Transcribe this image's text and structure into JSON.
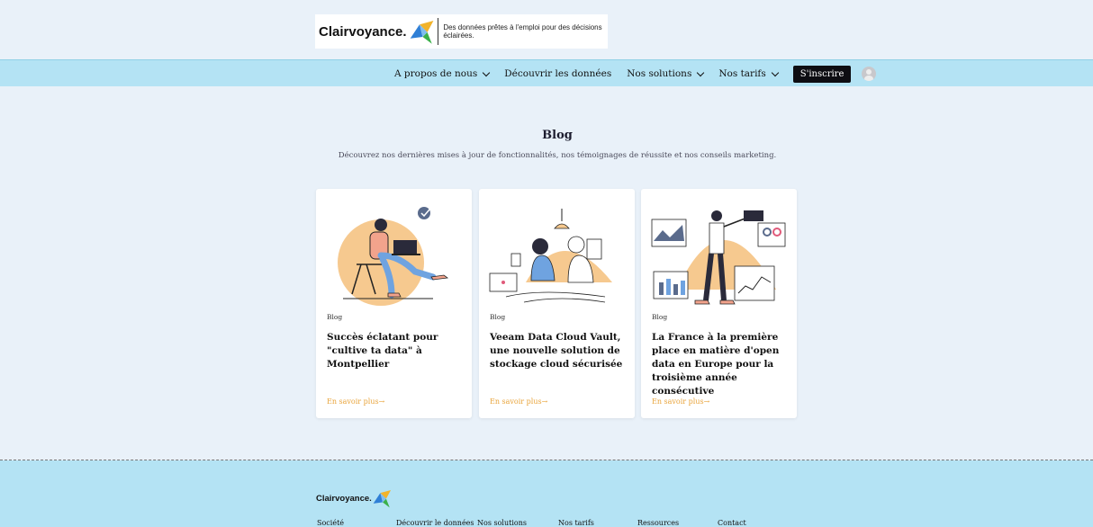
{
  "header": {
    "logo_text": "Clairvoyance.",
    "tagline": "Des données prêtes à l'emploi pour des décisions éclairées."
  },
  "nav": {
    "items": [
      {
        "label": "A propos de nous",
        "dropdown": true
      },
      {
        "label": "Découvrir les données",
        "dropdown": false
      },
      {
        "label": "Nos solutions",
        "dropdown": true
      },
      {
        "label": "Nos tarifs",
        "dropdown": true
      }
    ],
    "signup": "S'inscrire",
    "avatar_icon": "user-avatar-icon"
  },
  "main": {
    "title": "Blog",
    "subtitle": "Découvrez nos dernières mises à jour de fonctionnalités, nos témoignages de réussite et nos conseils marketing."
  },
  "cards": [
    {
      "category": "Blog",
      "title": "Succès éclatant pour \"cultive ta data\" à Montpellier",
      "link": "En savoir plus→",
      "illustration": "woman-laptop-chair-illustration"
    },
    {
      "category": "Blog",
      "title": "Veeam Data Cloud Vault, une nouvelle solution de stockage cloud sécurisée",
      "link": "En savoir plus→",
      "illustration": "two-people-working-illustration"
    },
    {
      "category": "Blog",
      "title": "La France à la première place en matière d'open data en Europe pour la troisième année consécutive",
      "link": "En savoir plus→",
      "illustration": "man-dashboard-charts-illustration"
    }
  ],
  "footer": {
    "logo_text": "Clairvoyance.",
    "columns": [
      "Société",
      "Découvrir le données",
      "Nos solutions",
      "Nos tarifs",
      "Ressources",
      "Contact"
    ]
  },
  "colors": {
    "background": "#e9f1f9",
    "nav_bg": "#b4e3f4",
    "accent_orange": "#e9a43b",
    "button_dark": "#0d0d12"
  }
}
